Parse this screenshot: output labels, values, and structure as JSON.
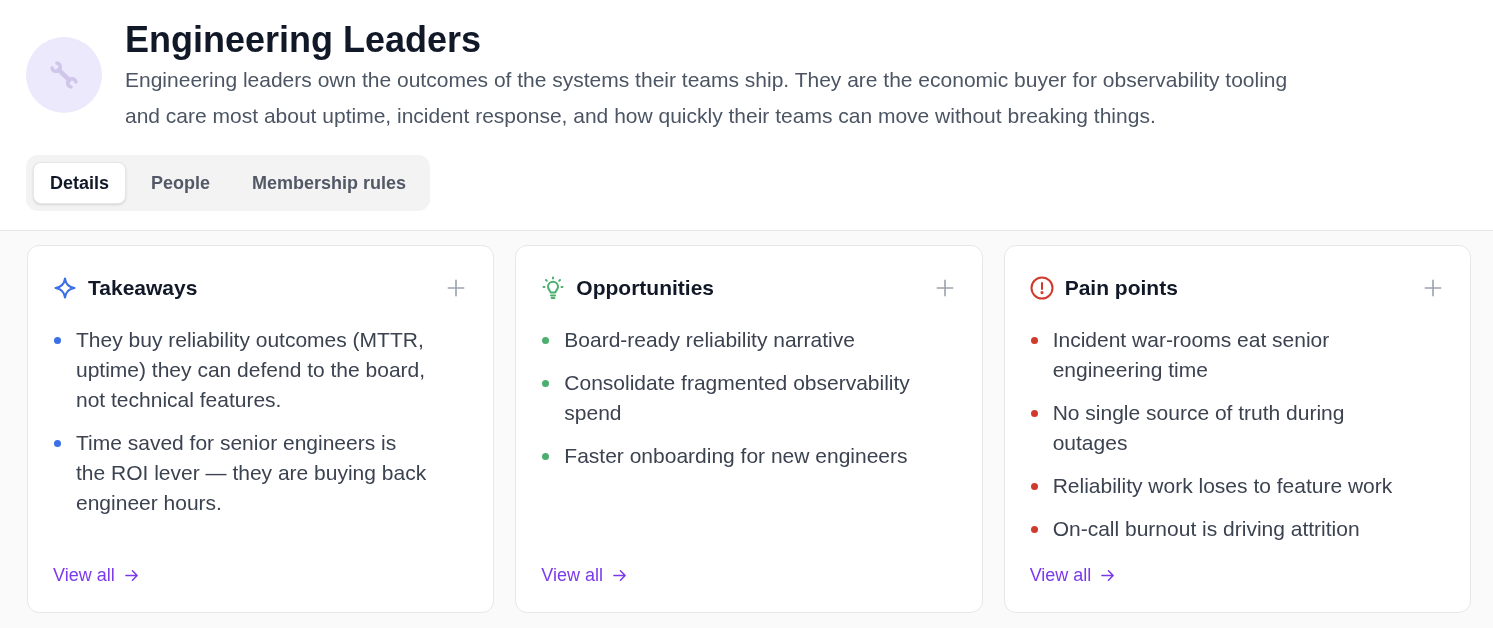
{
  "header": {
    "title": "Engineering Leaders",
    "description": "Engineering leaders own the outcomes of the systems their teams ship. They are the economic buyer for observability tooling and care most about uptime, incident response, and how quickly their teams can move without breaking things."
  },
  "tabs": [
    {
      "label": "Details",
      "selected": true
    },
    {
      "label": "People",
      "selected": false
    },
    {
      "label": "Membership rules",
      "selected": false
    }
  ],
  "cards": [
    {
      "kind": "sparkle",
      "title": "Takeaways",
      "color": "#3b6fe8",
      "items": [
        "They buy reliability outcomes (MTTR, uptime) they can defend to the board, not technical features.",
        "Time saved for senior engineers is the ROI lever — they are buying back engineer hours."
      ],
      "link": "View all"
    },
    {
      "kind": "bulb",
      "title": "Opportunities",
      "color": "#4caf6e",
      "items": [
        "Board-ready reliability narrative",
        "Consolidate fragmented observability spend",
        "Faster onboarding for new engineers"
      ],
      "link": "View all"
    },
    {
      "kind": "alert",
      "title": "Pain points",
      "color": "#cf3a2c",
      "items": [
        "Incident war-rooms eat senior engineering time",
        "No single source of truth during outages",
        "Reliability work loses to feature work",
        "On-call burnout is driving attrition"
      ],
      "link": "View all"
    }
  ]
}
